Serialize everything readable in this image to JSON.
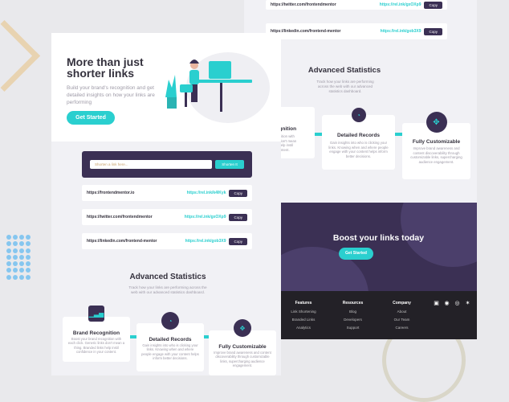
{
  "colors": {
    "teal": "#2acfcf",
    "violet": "#3b3054",
    "dark": "#232127",
    "gray": "#9e9aa7"
  },
  "desktop": {
    "links": [
      {
        "original": "https://twitter.com/frontendmentor",
        "short": "https://rel.ink/gxOXp9",
        "copy": "Copy"
      },
      {
        "original": "https://linkedin.com/frontend-mentor",
        "short": "https://rel.ink/gob3X9",
        "copy": "Copy"
      }
    ],
    "stats": {
      "title": "Advanced Statistics",
      "desc": "Track how your links are performing across the web with our advanced statistics dashboard."
    },
    "cards": [
      {
        "icon": "chart-icon",
        "title": "Brand Recognition",
        "desc": "Boost your brand recognition with each click. Generic links don't mean a thing. Branded links help instil confidence in your content."
      },
      {
        "icon": "gauge-icon",
        "title": "Detailed Records",
        "desc": "Gain insights into who is clicking your links. Knowing when and where people engage with your content helps inform better decisions."
      },
      {
        "icon": "brush-icon",
        "title": "Fully Customizable",
        "desc": "Improve brand awareness and content discoverability through customizable links, supercharging audience engagement."
      }
    ],
    "boost": {
      "title": "Boost your links today",
      "button": "Get Started"
    },
    "footer": {
      "columns": [
        {
          "title": "Features",
          "items": [
            "Link Shortening",
            "Branded Links",
            "Analytics"
          ]
        },
        {
          "title": "Resources",
          "items": [
            "Blog",
            "Developers",
            "Support"
          ]
        },
        {
          "title": "Company",
          "items": [
            "About",
            "Our Team",
            "Careers"
          ]
        }
      ],
      "social": [
        "facebook-icon",
        "instagram-icon",
        "pinterest-icon",
        "twitter-icon"
      ]
    }
  },
  "mobile": {
    "hero": {
      "title": "More than just shorter links",
      "text": "Build your brand's recognition and get detailed insights on how your links are performing",
      "button": "Get Started"
    },
    "shorten": {
      "placeholder": "Shorten a link here...",
      "button": "Shorten It"
    },
    "links": [
      {
        "original": "https://frontendmentor.io",
        "short": "https://rel.ink/k4lKyk",
        "copy": "Copy"
      },
      {
        "original": "https://twitter.com/frontendmentor",
        "short": "https://rel.ink/gxOXp9",
        "copy": "Copy"
      },
      {
        "original": "https://linkedin.com/frontend-mentor",
        "short": "https://rel.ink/gob3X9",
        "copy": "Copy"
      }
    ],
    "stats": {
      "title": "Advanced Statistics",
      "desc": "Track how your links are performing across the web with our advanced statistics dashboard."
    }
  }
}
